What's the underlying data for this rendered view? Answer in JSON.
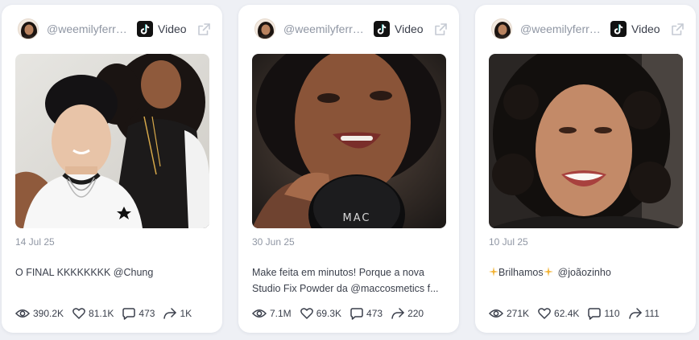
{
  "posts": [
    {
      "handle": "@weemilyferre...",
      "type": "Video",
      "date": "14 Jul 25",
      "caption_lines": [
        "O FINAL KKKKKKKK @Chung"
      ],
      "stats": {
        "views": "390.2K",
        "likes": "81.1K",
        "comments": "473",
        "shares": "1K"
      }
    },
    {
      "handle": "@weemilyferre...",
      "type": "Video",
      "date": "30 Jun 25",
      "caption_lines": [
        "Make feita em minutos! Porque a nova",
        "Studio Fix Powder da @maccosmetics f..."
      ],
      "stats": {
        "views": "7.1M",
        "likes": "69.3K",
        "comments": "473",
        "shares": "220"
      }
    },
    {
      "handle": "@weemilyferre...",
      "type": "Video",
      "date": "10 Jul 25",
      "caption_lines": [
        "Brilhamos",
        "@joãozinho"
      ],
      "stats": {
        "views": "271K",
        "likes": "62.4K",
        "comments": "110",
        "shares": "111"
      }
    }
  ],
  "media_brand_text": "MAC",
  "icons": {
    "views": "eye-icon",
    "likes": "heart-icon",
    "comments": "comment-icon",
    "shares": "share-icon",
    "platform": "tiktok-icon",
    "external": "external-link-icon",
    "sparkle": "sparkle-icon"
  },
  "colors": {
    "page_bg": "#eef0f5",
    "card_bg": "#ffffff",
    "muted_text": "#8f96a3",
    "body_text": "#3a3f4b",
    "sparkle": "#f2b233"
  }
}
